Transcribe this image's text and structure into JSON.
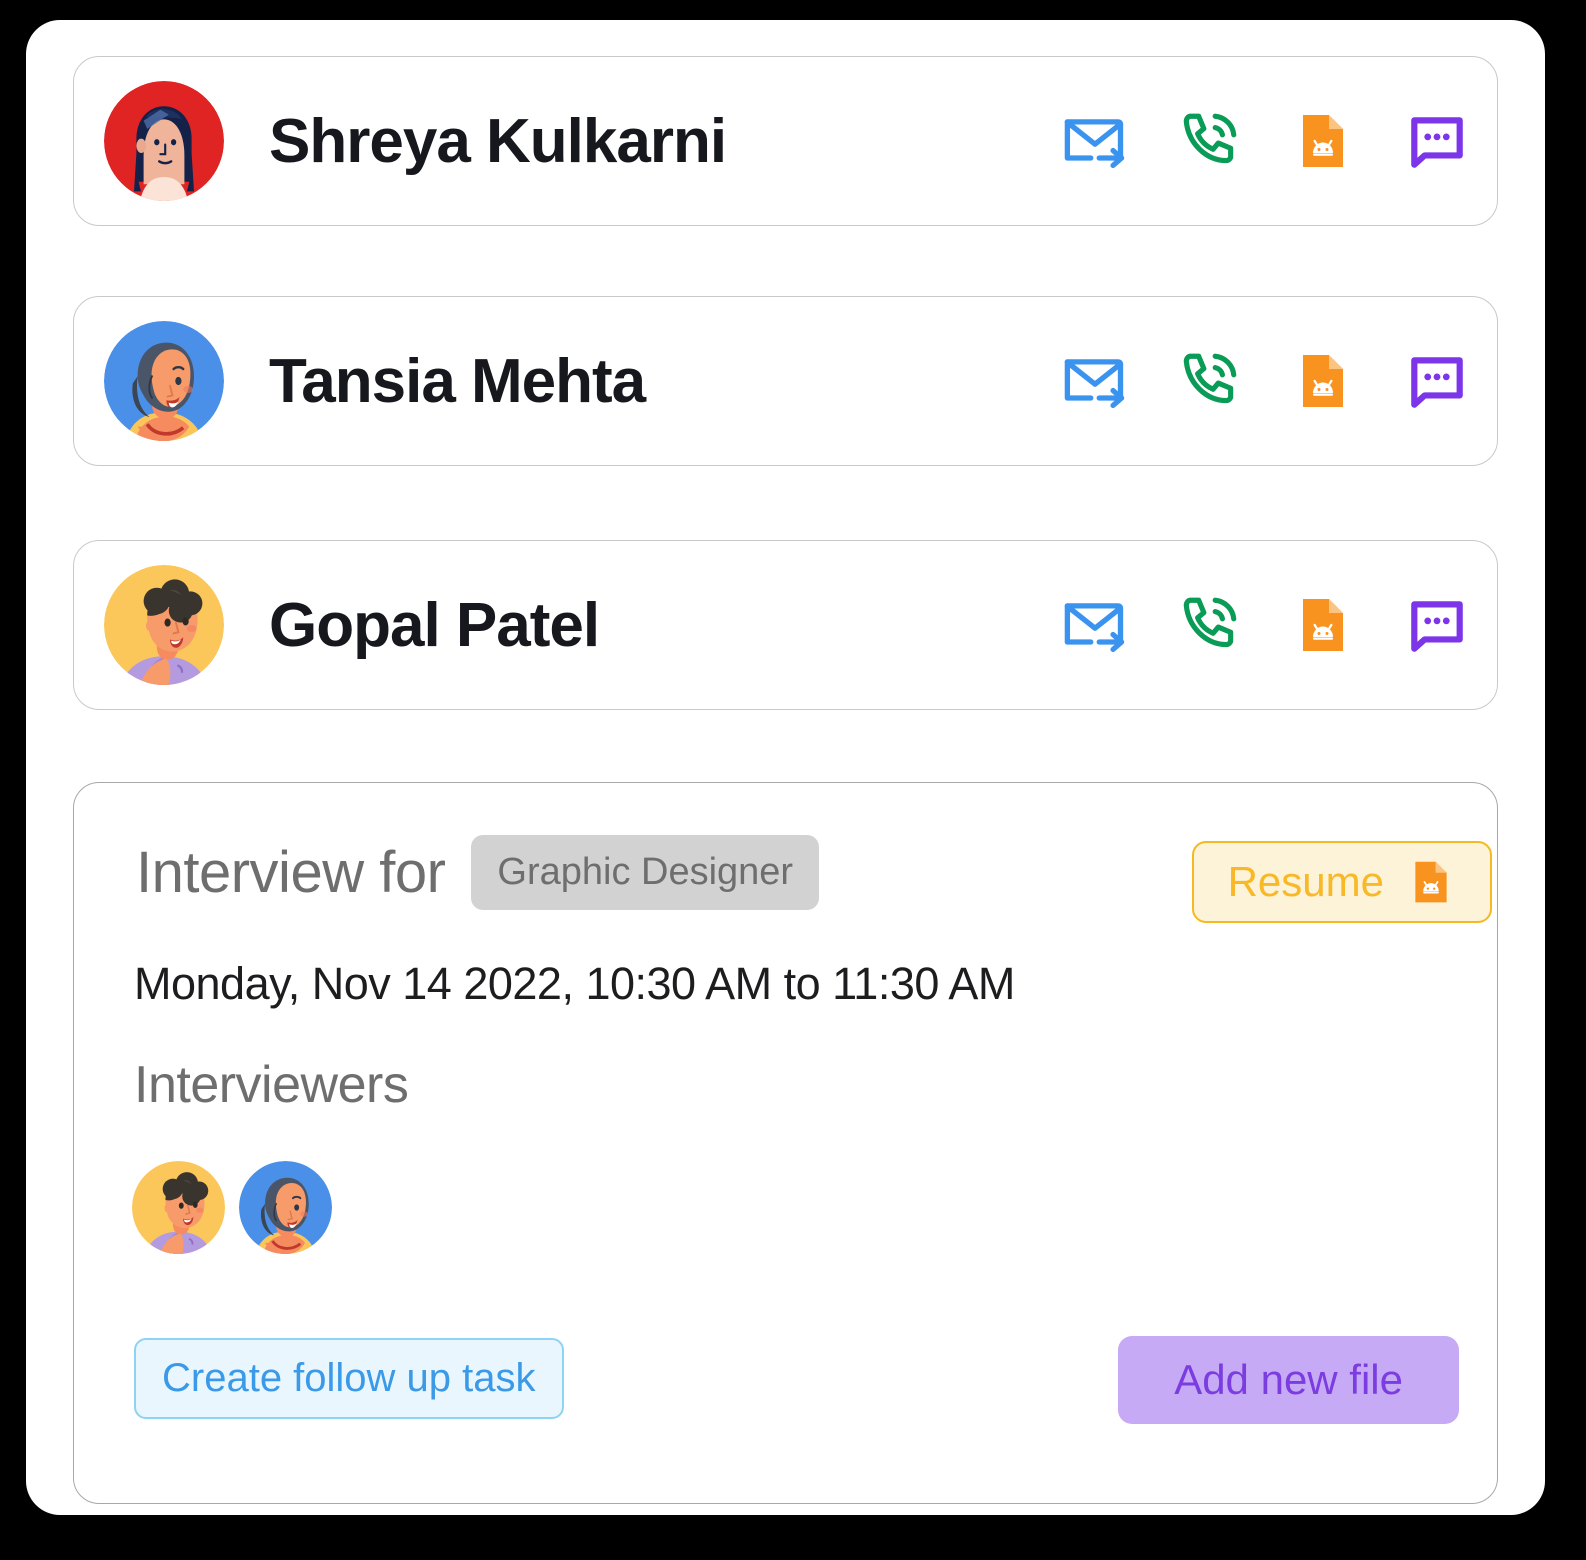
{
  "candidates": [
    {
      "name": "Shreya Kulkarni",
      "avatar": "avatar-shreya",
      "actions": [
        {
          "name": "send-email-icon",
          "label": "Send email",
          "color": "#3b93f0"
        },
        {
          "name": "phone-call-icon",
          "label": "Call",
          "color": "#0a9b56"
        },
        {
          "name": "resume-file-icon",
          "label": "Resume file",
          "color": "#f7931e"
        },
        {
          "name": "chat-message-icon",
          "label": "Message",
          "color": "#7c35e8"
        }
      ]
    },
    {
      "name": "Tansia Mehta",
      "avatar": "avatar-tansia",
      "actions": [
        {
          "name": "send-email-icon",
          "label": "Send email",
          "color": "#3b93f0"
        },
        {
          "name": "phone-call-icon",
          "label": "Call",
          "color": "#0a9b56"
        },
        {
          "name": "resume-file-icon",
          "label": "Resume file",
          "color": "#f7931e"
        },
        {
          "name": "chat-message-icon",
          "label": "Message",
          "color": "#7c35e8"
        }
      ]
    },
    {
      "name": "Gopal Patel",
      "avatar": "avatar-gopal",
      "actions": [
        {
          "name": "send-email-icon",
          "label": "Send email",
          "color": "#3b93f0"
        },
        {
          "name": "phone-call-icon",
          "label": "Call",
          "color": "#0a9b56"
        },
        {
          "name": "resume-file-icon",
          "label": "Resume file",
          "color": "#f7931e"
        },
        {
          "name": "chat-message-icon",
          "label": "Message",
          "color": "#7c35e8"
        }
      ]
    }
  ],
  "detail": {
    "headline": "Interview for",
    "role": "Graphic Designer",
    "resume_label": "Resume",
    "date": "Monday, Nov 14 2022, 10:30 AM to 11:30 AM",
    "interviewers_label": "Interviewers",
    "interviewers": [
      "avatar-gopal",
      "avatar-tansia"
    ],
    "followup_label": "Create follow up task",
    "addfile_label": "Add new file"
  },
  "colors": {
    "email_blue": "#3b93f0",
    "phone_green": "#0a9b56",
    "file_orange": "#f7931e",
    "chat_purple": "#7c35e8",
    "resume_amber": "#f8b828",
    "resume_bg": "#fdf3d8",
    "chip_gray": "#d2d2d2",
    "followup_blue": "#3b9ae8",
    "followup_bg": "#eaf6fd",
    "addfile_purple": "#7b3ce0",
    "addfile_bg": "#c7aaf5"
  }
}
